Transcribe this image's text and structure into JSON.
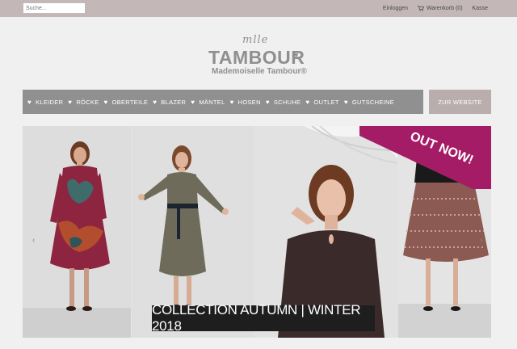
{
  "topbar": {
    "search_placeholder": "Suche...",
    "login_label": "Einloggen",
    "cart_label": "Warenkorb (0)",
    "checkout_label": "Kasse"
  },
  "logo": {
    "script": "mlle",
    "main": "TAMBOUR",
    "sub": "Mademoiselle Tambour®"
  },
  "nav": {
    "items": [
      {
        "label": "KLEIDER"
      },
      {
        "label": "RÖCKE"
      },
      {
        "label": "OBERTEILE"
      },
      {
        "label": "BLAZER"
      },
      {
        "label": "MÄNTEL"
      },
      {
        "label": "HOSEN"
      },
      {
        "label": "SCHUHE"
      },
      {
        "label": "OUTLET"
      },
      {
        "label": "GUTSCHEINE"
      }
    ],
    "website_button": "ZUR WEBSITE"
  },
  "slider": {
    "caption": "COLLECTION AUTUMN | WINTER 2018",
    "badge": "OUT NOW!",
    "prev_icon": "chevron-left-icon",
    "next_icon": "chevron-right-icon"
  },
  "colors": {
    "topbar": "#c3b7b8",
    "nav": "#909090",
    "website_button": "#b9adae",
    "badge": "#a51c66",
    "caption": "#1e1e1e"
  }
}
